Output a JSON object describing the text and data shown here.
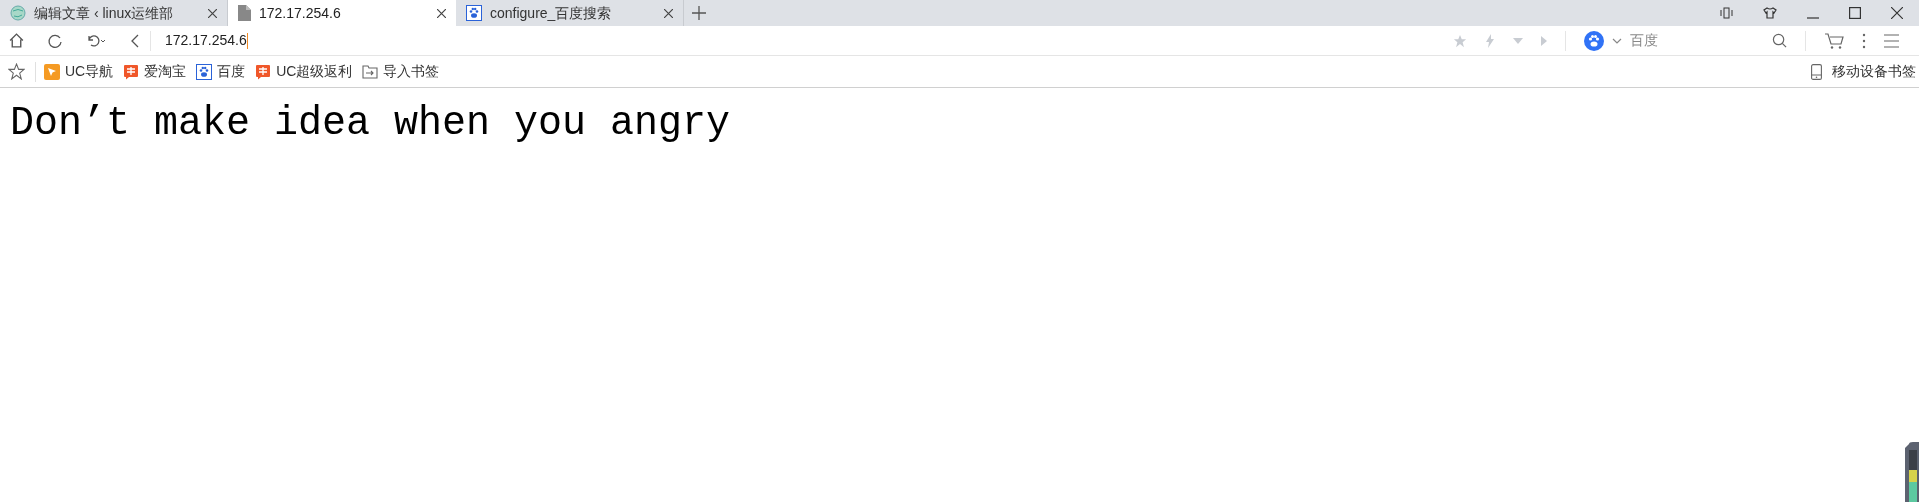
{
  "tabs": [
    {
      "title": "编辑文章 ‹ linux运维部",
      "kind": "globe",
      "selected": false
    },
    {
      "title": "172.17.254.6",
      "kind": "page",
      "selected": true
    },
    {
      "title": "configure_百度搜索",
      "kind": "paw",
      "selected": false
    }
  ],
  "address_bar": {
    "value": "172.17.254.6"
  },
  "search": {
    "engine": "百度"
  },
  "bookmarks": [
    {
      "label": "UC导航",
      "kind": "uc"
    },
    {
      "label": "爱淘宝",
      "kind": "tao"
    },
    {
      "label": "百度",
      "kind": "paw"
    },
    {
      "label": "UC超级返利",
      "kind": "tao"
    },
    {
      "label": "导入书签",
      "kind": "import"
    }
  ],
  "mobile_bookmarks": "移动设备书签",
  "page": {
    "heading": "Don’t make idea when you angry"
  }
}
